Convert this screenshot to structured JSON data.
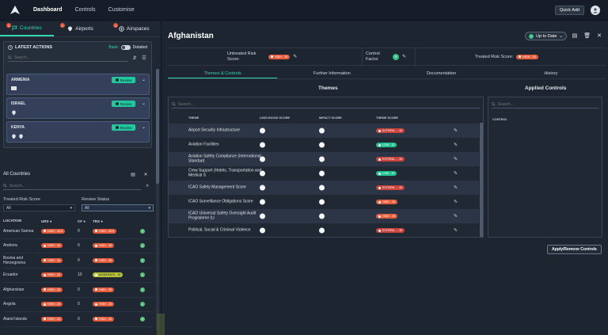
{
  "topbar": {
    "nav": [
      "Dashboard",
      "Controls",
      "Customise"
    ],
    "quick_add": "Quick Add"
  },
  "left": {
    "tabs": [
      {
        "label": "Countries",
        "badge": "1"
      },
      {
        "label": "Airports",
        "badge": "1"
      },
      {
        "label": "Airspaces",
        "badge": "1"
      }
    ],
    "latest_actions": {
      "title": "LATEST ACTIONS",
      "basic": "Basic",
      "detailed": "Detailed",
      "search_placeholder": "Search...",
      "cards": [
        {
          "name": "ARMENIA",
          "status": "Review"
        },
        {
          "name": "ISRAEL",
          "status": "Review"
        },
        {
          "name": "KENYA",
          "status": "Review"
        }
      ]
    },
    "all_countries": {
      "title": "All Countries",
      "search_placeholder": "Search...",
      "filter_trs_label": "Treated Risk Score",
      "filter_trs_value": "All",
      "filter_review_label": "Review Status",
      "filter_review_value": "All",
      "columns": [
        "LOCATION",
        "URS",
        "CF",
        "TRS"
      ],
      "rows": [
        {
          "location": "American Samoa",
          "urs": "HIGH - 40.8",
          "cf": "0",
          "trs": "HIGH - 40.8",
          "urs_level": "high",
          "trs_level": "high"
        },
        {
          "location": "Andorra",
          "urs": "HIGH - 36",
          "cf": "0",
          "trs": "HIGH - 36",
          "urs_level": "high",
          "trs_level": "high"
        },
        {
          "location": "Bosnia and Herzegovina",
          "urs": "HIGH - 36",
          "cf": "0",
          "trs": "HIGH - 36",
          "urs_level": "high",
          "trs_level": "high"
        },
        {
          "location": "Ecuador",
          "urs": "HIGH - 26",
          "cf": "10",
          "trs": "MODERATE - 16",
          "urs_level": "high",
          "trs_level": "moderate"
        },
        {
          "location": "Afghanistan",
          "urs": "HIGH - 25",
          "cf": "0",
          "trs": "HIGH - 25",
          "urs_level": "high",
          "trs_level": "high"
        },
        {
          "location": "Angola",
          "urs": "HIGH - 25",
          "cf": "0",
          "trs": "HIGH - 25",
          "urs_level": "high",
          "trs_level": "high"
        },
        {
          "location": "Aland Islands",
          "urs": "HIGH - 24",
          "cf": "0",
          "trs": "HIGH - 24",
          "urs_level": "high",
          "trs_level": "high"
        }
      ]
    }
  },
  "main": {
    "title": "Afghanistan",
    "status": "Up to Date",
    "untreated_label": "Untreated Risk Score:",
    "untreated_value": "HIGH - 25",
    "control_factor_label": "Control Factor",
    "control_factor_value": "0",
    "treated_label": "Treated Risk Score:",
    "treated_value": "HIGH - 25",
    "tabs": [
      "Themes & Controls",
      "Further Information",
      "Documentation",
      "History"
    ],
    "themes_title": "Themes",
    "applied_title": "Applied Controls",
    "themes_search_placeholder": "Search...",
    "applied_search_placeholder": "Search...",
    "theme_columns": [
      "THEME",
      "LIKELIHOOD SCORE",
      "IMPACT SCORE",
      "THEME SCORE"
    ],
    "applied_columns": [
      "CONTROL"
    ],
    "themes": [
      {
        "name": "Airport Security Infrastructure",
        "score": "EXTREM... - 36",
        "level": "extreme"
      },
      {
        "name": "Aviation Facilities",
        "score": "LOW - 10",
        "level": "low"
      },
      {
        "name": "Aviation Safety Compliance (International Standard",
        "score": "EXTREM... - 36",
        "level": "extreme"
      },
      {
        "name": "Crew Support (Hotels, Transportation and Medical S",
        "score": "LOW - 15",
        "level": "low"
      },
      {
        "name": "ICAO Safety Management Score",
        "score": "EXTREM... - 36",
        "level": "extreme"
      },
      {
        "name": "ICAO Surveillance Obligations Score",
        "score": "HIGH - 20",
        "level": "high"
      },
      {
        "name": "ICAO Universal Safety Oversight Audit Programme (U",
        "score": "HIGH - 25",
        "level": "high"
      },
      {
        "name": "Political, Social & Criminal Violence",
        "score": "EXTREM... - 36",
        "level": "extreme"
      }
    ],
    "apply_button": "Apply/Remove Controls"
  }
}
